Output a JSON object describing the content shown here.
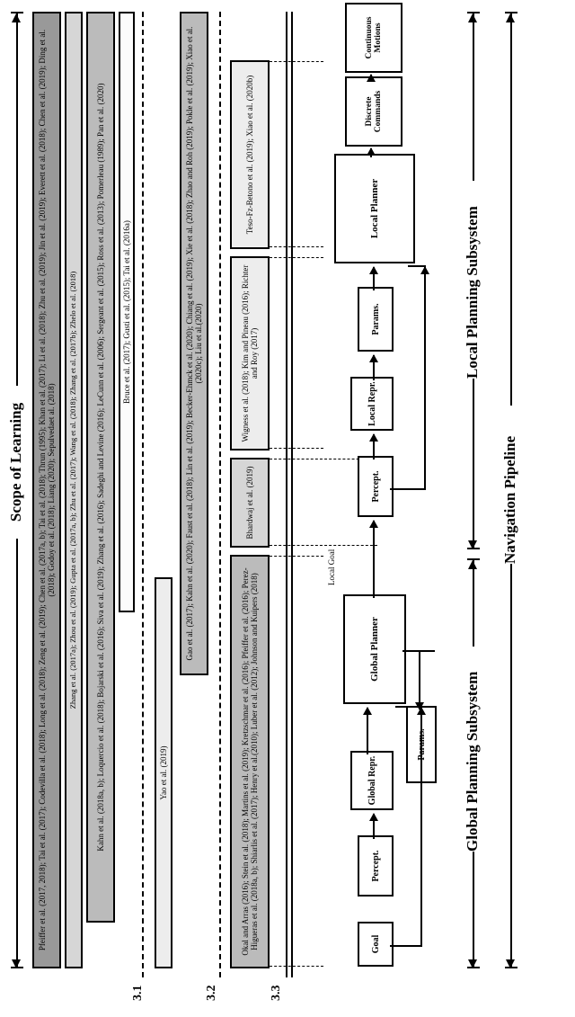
{
  "scope_label": "Scope of Learning",
  "sections": {
    "s31": "3.1",
    "s32": "3.2",
    "s33": "3.3"
  },
  "bars": {
    "s31_a": "Pfeiffer et al. (2017, 2018); Tai et al. (2017); Codevilla et al. (2018); Long et al. (2018); Zeng et al. (2019); Chen et al. (2017a, b); Tai et al. (2018); Thrun (1995); Khan et al. (2017); Li et al. (2018); Zhu et al. (2019); Jin et al. (2019); Everett et al. (2018); Chen et al. (2019); Ding et al. (2018); Godoy et al. (2018); Liang (2020); Sepulvedaet al. (2018)",
    "s31_b": "Zhang et al. (2017a); Zhou et al. (2019); Gupta et al. (2017a, b); Zhu et al. (2017); Wang et al. (2018); Zhang et al. (2017b); Zhelo et al. (2018)",
    "s31_c": "Kahn et al. (2018a, b); Loquercio et al. (2018); Bojarski et al. (2016); Siva et al. (2019); Zhang et al. (2016); Sadeghi and Levine (2016); LeCunn et al. (2006); Sergeant et al. (2015); Ross et al. (2013); Pomerleau (1989); Pan et al. (2020)",
    "s31_d": "Bruce et al. (2017); Gusti et al. (2015); Tai et al. (2016a)",
    "s32_a": "Yao et al. (2019)",
    "s32_b": "Gao et al. (2017); Kahn et al. (2020); Faust et al. (2018); Lin et al. (2019); Becker-Ehmck et al. (2020); Chiang et al. (2019); Xie et al. (2018); Zhao and Roh (2019); Pokle et al. (2019); Xiao et al. (2020c); Liu et al.(2020)",
    "s33_left": "Okal and Arras (2016); Stein et al. (2018); Martins et al. (2019); Kretzschmar et al. (2016); Pfeiffer et al. (2016); Perez-Higueras et al. (2018a, b); Shiarlis et al. (2017); Henry et al.(2010); Luber et al. (2012); Johnson and Kuipers (2018)",
    "s33_mid": "Bhardwaj et al. (2019)",
    "s33_r1": "Wigness et al. (2018); Kim and Pineau (2016); Richter and Roy (2017)",
    "s33_r2": "Teso-Fz-Betono et al. (2019); Xiao et al. (2020b)"
  },
  "pipeline": {
    "goal": "Goal",
    "g_percept": "Percept.",
    "g_repr": "Global Repr.",
    "g_params": "Params.",
    "g_planner": "Global Planner",
    "local_goal": "Local Goal",
    "l_percept": "Percept.",
    "l_repr": "Local Repr.",
    "l_params": "Params.",
    "l_planner": "Local Planner",
    "discrete": "Discrete Commands",
    "continuous": "Continuous Motions"
  },
  "brackets": {
    "nav": "Navigation Pipeline",
    "global": "Global Planning Subsystem",
    "local": "Local Planning Subsystem"
  }
}
